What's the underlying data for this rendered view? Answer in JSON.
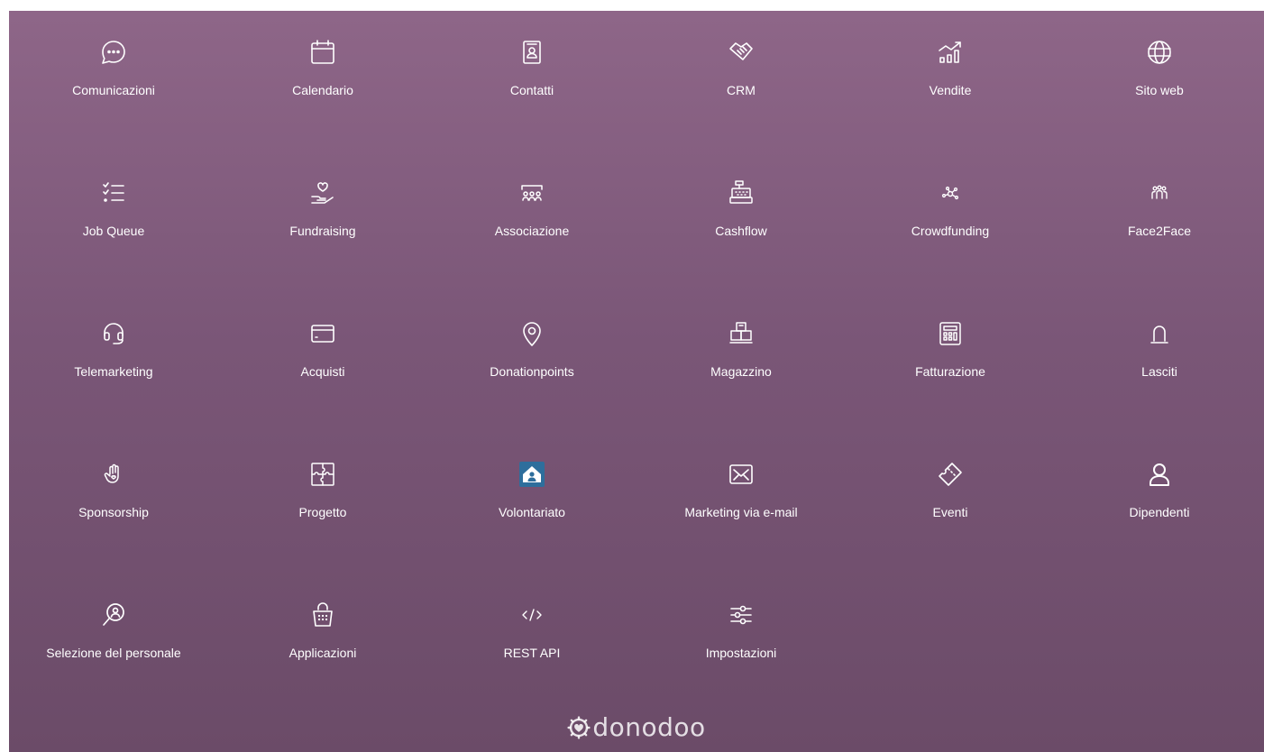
{
  "apps": [
    {
      "label": "Comunicazioni",
      "icon": "chat-bubble-icon"
    },
    {
      "label": "Calendario",
      "icon": "calendar-icon"
    },
    {
      "label": "Contatti",
      "icon": "contact-card-icon"
    },
    {
      "label": "CRM",
      "icon": "handshake-icon"
    },
    {
      "label": "Vendite",
      "icon": "sales-chart-icon"
    },
    {
      "label": "Sito web",
      "icon": "globe-icon"
    },
    {
      "label": "Job Queue",
      "icon": "checklist-icon"
    },
    {
      "label": "Fundraising",
      "icon": "heart-hand-icon"
    },
    {
      "label": "Associazione",
      "icon": "people-group-icon"
    },
    {
      "label": "Cashflow",
      "icon": "cash-register-icon"
    },
    {
      "label": "Crowdfunding",
      "icon": "network-icon"
    },
    {
      "label": "Face2Face",
      "icon": "people-face-icon"
    },
    {
      "label": "Telemarketing",
      "icon": "headset-icon"
    },
    {
      "label": "Acquisti",
      "icon": "credit-card-icon"
    },
    {
      "label": "Donationpoints",
      "icon": "map-pin-icon"
    },
    {
      "label": "Magazzino",
      "icon": "boxes-icon"
    },
    {
      "label": "Fatturazione",
      "icon": "calculator-icon"
    },
    {
      "label": "Lasciti",
      "icon": "arch-icon"
    },
    {
      "label": "Sponsorship",
      "icon": "hand-heart-icon"
    },
    {
      "label": "Progetto",
      "icon": "puzzle-icon"
    },
    {
      "label": "Volontariato",
      "icon": "volunteer-house-icon"
    },
    {
      "label": "Marketing via e-mail",
      "icon": "envelope-icon"
    },
    {
      "label": "Eventi",
      "icon": "ticket-icon"
    },
    {
      "label": "Dipendenti",
      "icon": "user-icon"
    },
    {
      "label": "Selezione del personale",
      "icon": "search-person-icon"
    },
    {
      "label": "Applicazioni",
      "icon": "app-basket-icon"
    },
    {
      "label": "REST API",
      "icon": "code-icon"
    },
    {
      "label": "Impostazioni",
      "icon": "sliders-icon"
    }
  ],
  "brand": {
    "name": "donodoo",
    "icon": "donodoo-logo-icon"
  },
  "colors": {
    "background_top": "#8e6688",
    "background_bottom": "#6b4b68",
    "text": "#ffffff",
    "volunteer_tile": "#2e6e9c"
  }
}
